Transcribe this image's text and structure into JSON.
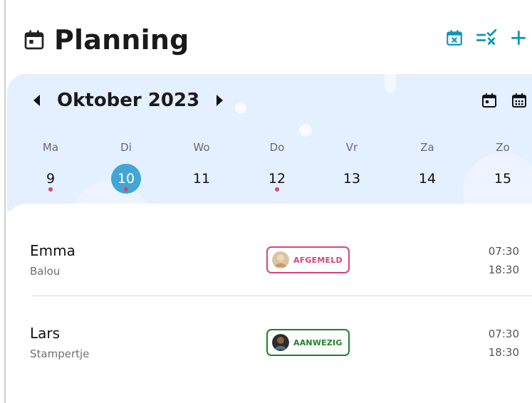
{
  "header": {
    "title": "Planning",
    "title_icon": "calendar-today-icon",
    "actions": [
      {
        "name": "calendar-cancel-icon"
      },
      {
        "name": "checklist-icon"
      },
      {
        "name": "plus-icon"
      }
    ],
    "accent_color": "#0d95bf"
  },
  "calendar": {
    "month_label": "Oktober 2023",
    "weekdays": [
      {
        "name": "Ma",
        "day": "9",
        "dot": true,
        "selected": false
      },
      {
        "name": "Di",
        "day": "10",
        "dot": true,
        "selected": true
      },
      {
        "name": "Wo",
        "day": "11",
        "dot": false,
        "selected": false
      },
      {
        "name": "Do",
        "day": "12",
        "dot": true,
        "selected": false
      },
      {
        "name": "Vr",
        "day": "13",
        "dot": false,
        "selected": false
      },
      {
        "name": "Za",
        "day": "14",
        "dot": false,
        "selected": false
      },
      {
        "name": "Zo",
        "day": "15",
        "dot": false,
        "selected": false
      }
    ],
    "panel_color": "#e4efff",
    "selected_color": "#41a6d3",
    "dot_color": "#d8437d"
  },
  "list": [
    {
      "name": "Emma",
      "group": "Balou",
      "status": "AFGEMELD",
      "status_color": "#d8437d",
      "start": "07:30",
      "end": "18:30"
    },
    {
      "name": "Lars",
      "group": "Stampertje",
      "status": "AANWEZIG",
      "status_color": "#22812a",
      "start": "07:30",
      "end": "18:30"
    }
  ]
}
